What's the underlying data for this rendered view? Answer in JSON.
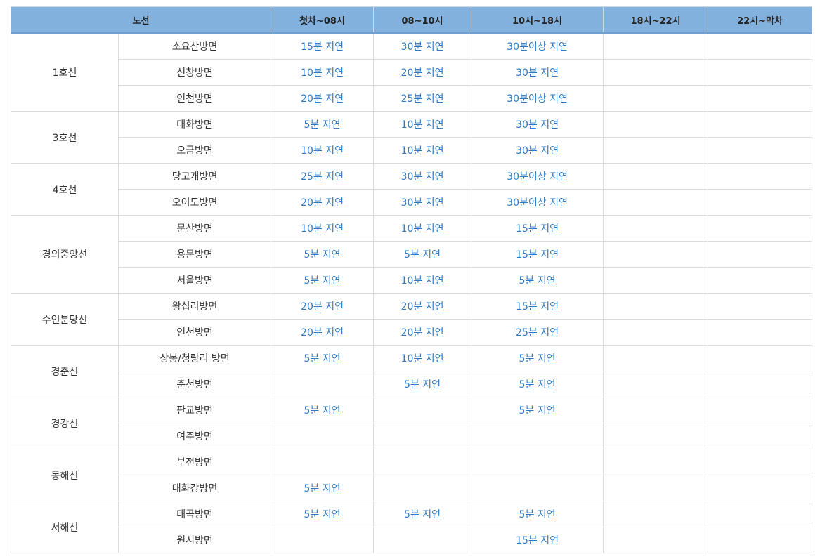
{
  "header": {
    "route": "노선",
    "slots": [
      "첫차~08시",
      "08~10시",
      "10시~18시",
      "18시~22시",
      "22시~막차"
    ]
  },
  "lines": [
    {
      "name": "1호선",
      "rows": [
        {
          "dir": "소요산방면",
          "v": [
            "15분 지연",
            "30분 지연",
            "30분이상 지연",
            "",
            ""
          ]
        },
        {
          "dir": "신창방면",
          "v": [
            "10분 지연",
            "20분 지연",
            "30분 지연",
            "",
            ""
          ]
        },
        {
          "dir": "인천방면",
          "v": [
            "20분 지연",
            "25분 지연",
            "30분이상 지연",
            "",
            ""
          ]
        }
      ]
    },
    {
      "name": "3호선",
      "rows": [
        {
          "dir": "대화방면",
          "v": [
            "5분 지연",
            "10분 지연",
            "30분 지연",
            "",
            ""
          ]
        },
        {
          "dir": "오금방면",
          "v": [
            "10분 지연",
            "10분 지연",
            "30분 지연",
            "",
            ""
          ]
        }
      ]
    },
    {
      "name": "4호선",
      "rows": [
        {
          "dir": "당고개방면",
          "v": [
            "25분 지연",
            "30분 지연",
            "30분이상 지연",
            "",
            ""
          ]
        },
        {
          "dir": "오이도방면",
          "v": [
            "20분 지연",
            "30분 지연",
            "30분이상 지연",
            "",
            ""
          ]
        }
      ]
    },
    {
      "name": "경의중앙선",
      "rows": [
        {
          "dir": "문산방면",
          "v": [
            "10분 지연",
            "10분 지연",
            "15분 지연",
            "",
            ""
          ]
        },
        {
          "dir": "용문방면",
          "v": [
            "5분 지연",
            "5분 지연",
            "15분 지연",
            "",
            ""
          ]
        },
        {
          "dir": "서울방면",
          "v": [
            "5분 지연",
            "10분 지연",
            "5분 지연",
            "",
            ""
          ]
        }
      ]
    },
    {
      "name": "수인분당선",
      "rows": [
        {
          "dir": "왕십리방면",
          "v": [
            "20분 지연",
            "20분 지연",
            "15분 지연",
            "",
            ""
          ]
        },
        {
          "dir": "인천방면",
          "v": [
            "20분 지연",
            "20분 지연",
            "25분 지연",
            "",
            ""
          ]
        }
      ]
    },
    {
      "name": "경춘선",
      "rows": [
        {
          "dir": "상봉/청량리 방면",
          "v": [
            "5분 지연",
            "10분 지연",
            "5분 지연",
            "",
            ""
          ]
        },
        {
          "dir": "춘천방면",
          "v": [
            "",
            "5분 지연",
            "5분 지연",
            "",
            ""
          ]
        }
      ]
    },
    {
      "name": "경강선",
      "rows": [
        {
          "dir": "판교방면",
          "v": [
            "5분 지연",
            "",
            "5분 지연",
            "",
            ""
          ]
        },
        {
          "dir": "여주방면",
          "v": [
            "",
            "",
            "",
            "",
            ""
          ]
        }
      ]
    },
    {
      "name": "동해선",
      "rows": [
        {
          "dir": "부전방면",
          "v": [
            "",
            "",
            "",
            "",
            ""
          ]
        },
        {
          "dir": "태화강방면",
          "v": [
            "5분 지연",
            "",
            "",
            "",
            ""
          ]
        }
      ]
    },
    {
      "name": "서해선",
      "rows": [
        {
          "dir": "대곡방면",
          "v": [
            "5분 지연",
            "5분 지연",
            "5분 지연",
            "",
            ""
          ]
        },
        {
          "dir": "원시방면",
          "v": [
            "",
            "",
            "15분 지연",
            "",
            ""
          ]
        }
      ]
    }
  ]
}
